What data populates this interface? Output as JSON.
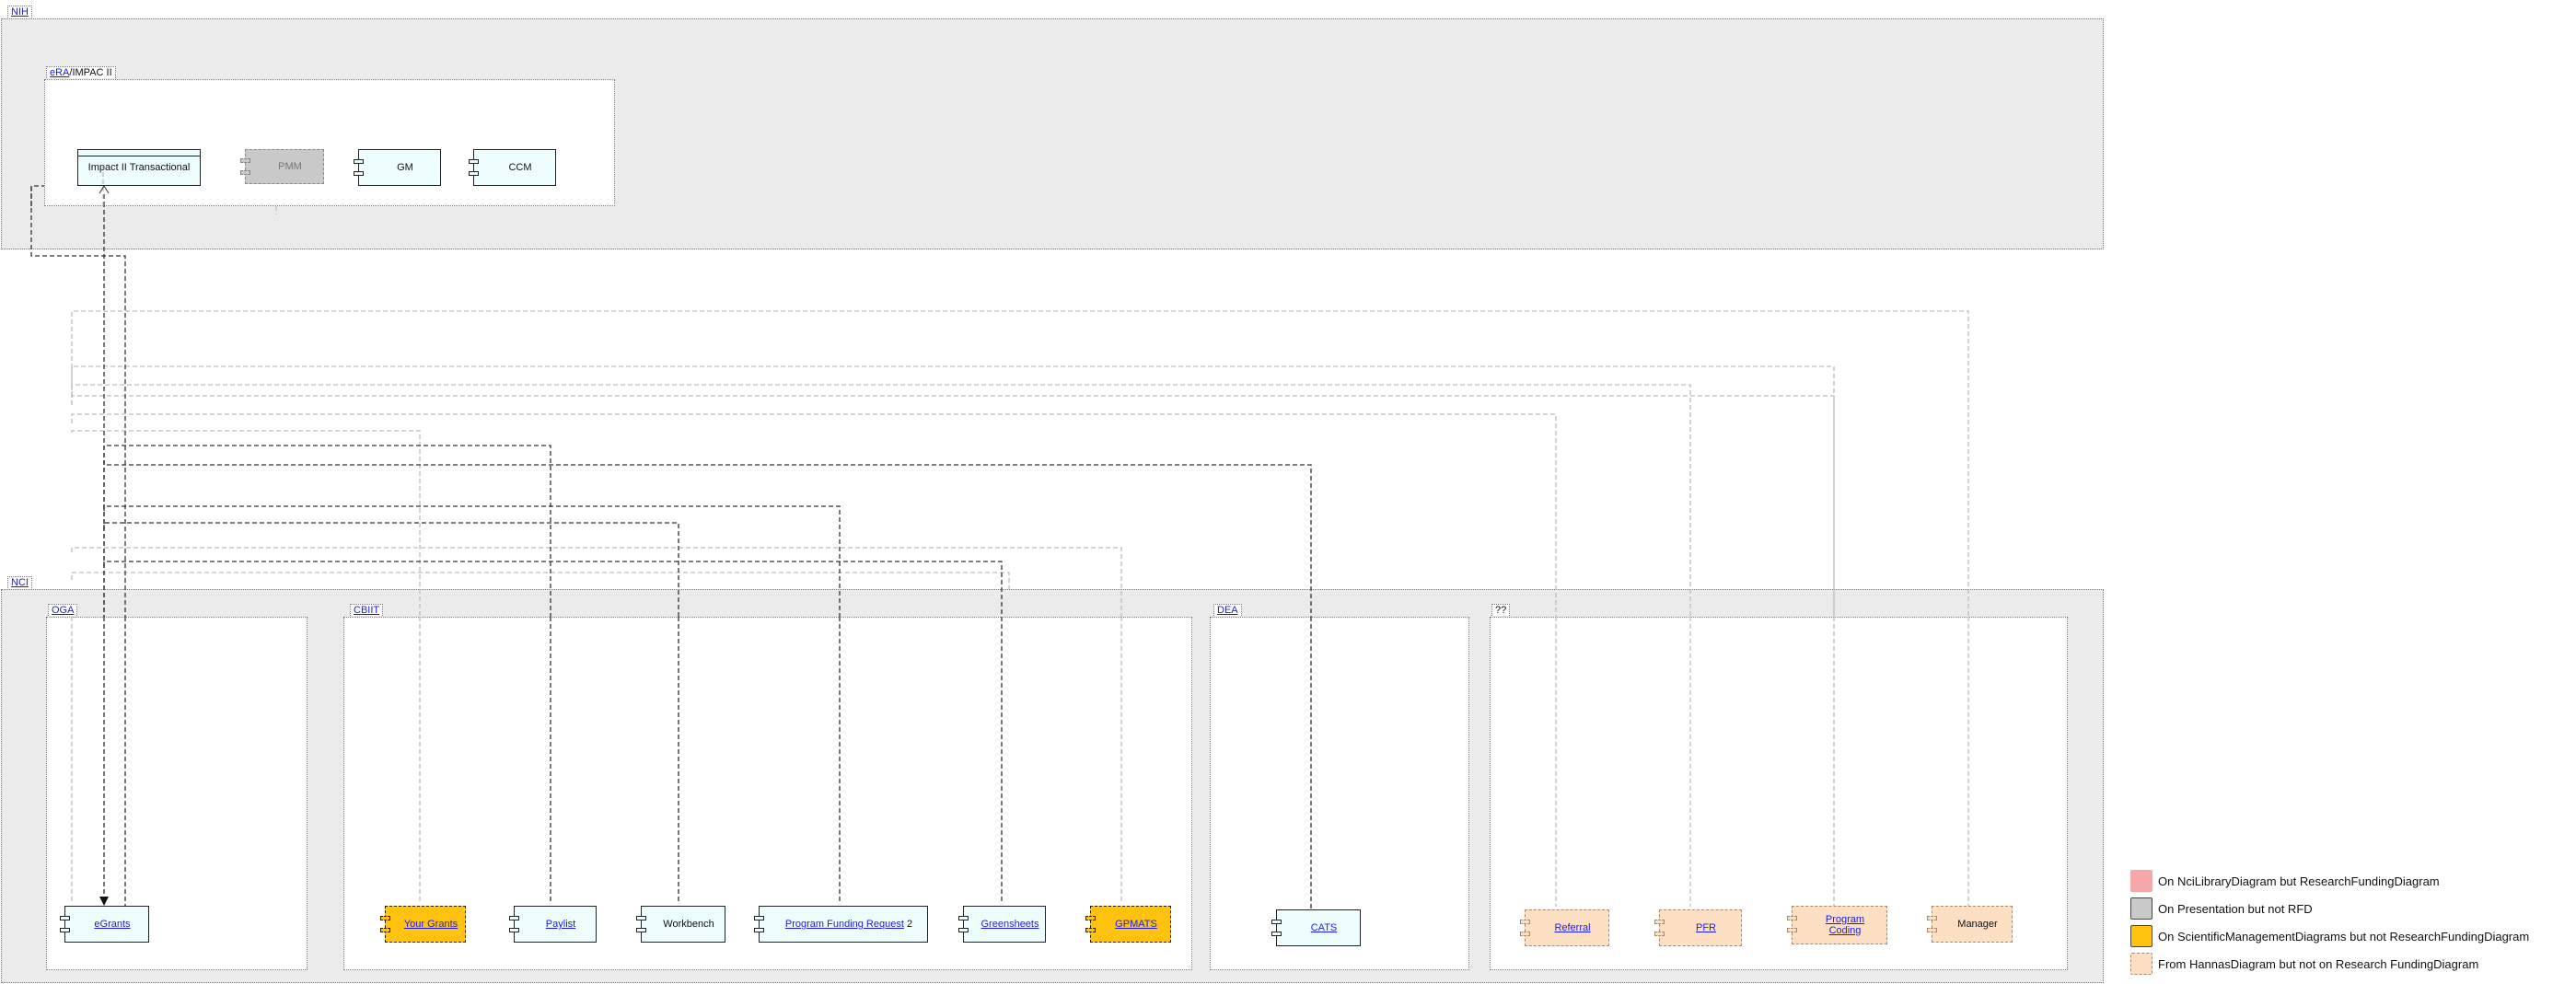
{
  "packages": {
    "nih": "NIH",
    "era_link": "eRA",
    "era_rest": "/IMPAC II",
    "nci": "NCI",
    "oga": "OGA",
    "cbiit": "CBIIT",
    "dea": "DEA",
    "unknown": "??"
  },
  "components": {
    "impact": "Impact II Transactional",
    "pmm": "PMM",
    "gm": "GM",
    "ccm": "CCM",
    "egrants": "eGrants",
    "your_grants": "Your Grants",
    "paylist": "Paylist",
    "workbench": "Workbench",
    "pfr_link": "Program Funding Request",
    "pfr_suffix": " 2",
    "greensheets": "Greensheets",
    "gpmats": "GPMATS",
    "cats": "CATS",
    "referral": "Referral",
    "pfr": "PFR",
    "program_coding": "Program Coding",
    "manager": "Manager"
  },
  "legend": [
    {
      "label": "On NciLibraryDiagram but ResearchFundingDiagram",
      "color": "#f6a8a8"
    },
    {
      "label": "On Presentation but not RFD",
      "color": "#c9c9c9"
    },
    {
      "label": "On ScientificManagementDiagrams but not ResearchFundingDiagram",
      "color": "#ffc20e"
    },
    {
      "label": "From HannasDiagram but not on Research FundingDiagram",
      "color": "#fde0c3"
    }
  ]
}
